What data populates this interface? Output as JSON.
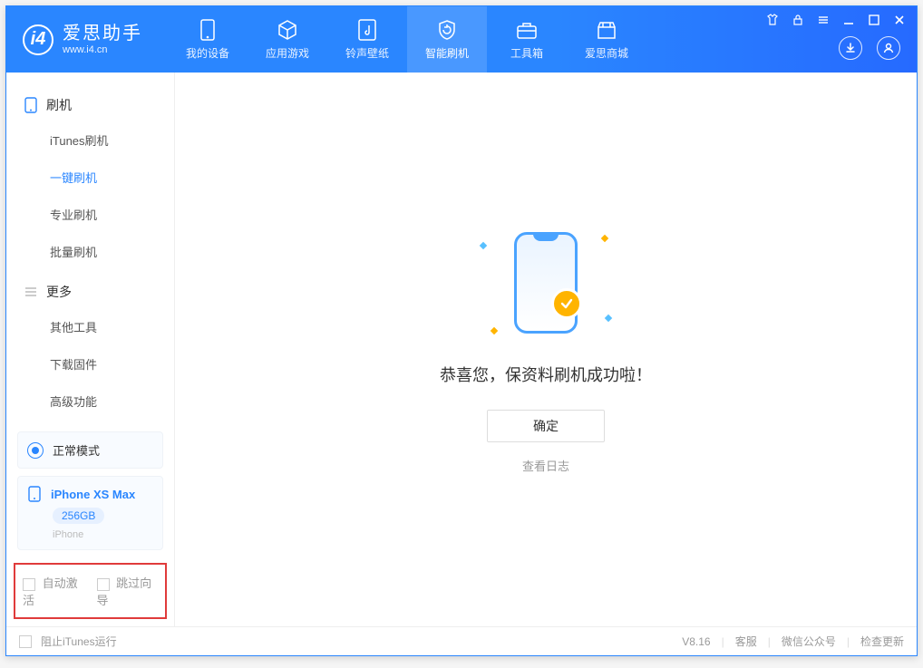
{
  "brand": {
    "name": "爱思助手",
    "url": "www.i4.cn"
  },
  "tabs": {
    "device": "我的设备",
    "apps": "应用游戏",
    "ring": "铃声壁纸",
    "flash": "智能刷机",
    "tools": "工具箱",
    "store": "爱思商城"
  },
  "sidebar": {
    "group_flash": "刷机",
    "items_flash": {
      "itunes": "iTunes刷机",
      "one_click": "一键刷机",
      "pro": "专业刷机",
      "batch": "批量刷机"
    },
    "group_more": "更多",
    "items_more": {
      "other": "其他工具",
      "firmware": "下载固件",
      "advanced": "高级功能"
    }
  },
  "mode": {
    "label": "正常模式"
  },
  "device": {
    "name": "iPhone XS Max",
    "storage": "256GB",
    "type": "iPhone"
  },
  "options": {
    "auto_activate": "自动激活",
    "skip_setup": "跳过向导"
  },
  "main": {
    "message": "恭喜您，保资料刷机成功啦！",
    "ok": "确定",
    "log": "查看日志"
  },
  "footer": {
    "block_itunes": "阻止iTunes运行",
    "version": "V8.16",
    "service": "客服",
    "wechat": "微信公众号",
    "update": "检查更新"
  }
}
